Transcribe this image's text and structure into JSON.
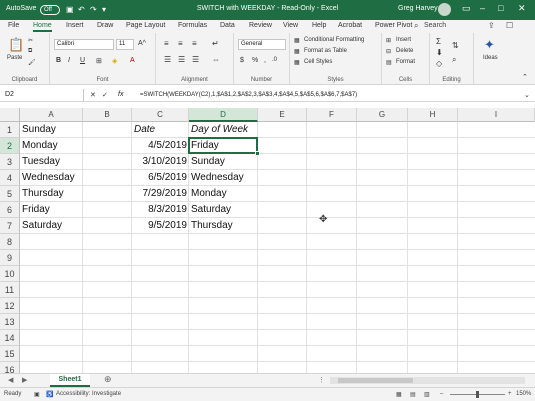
{
  "titlebar": {
    "autosave_label": "AutoSave",
    "autosave_state": "Off",
    "title": "SWITCH with WEEKDAY - Read-Only - Excel",
    "user": "Greg Harvey"
  },
  "tabs": [
    "File",
    "Home",
    "Insert",
    "Draw",
    "Page Layout",
    "Formulas",
    "Data",
    "Review",
    "View",
    "Help",
    "Acrobat",
    "Power Pivot"
  ],
  "active_tab": "Home",
  "search_label": "Search",
  "ribbon": {
    "clipboard": {
      "paste": "Paste",
      "label": "Clipboard"
    },
    "font": {
      "name": "Calibri",
      "size": "11",
      "label": "Font"
    },
    "alignment": {
      "label": "Alignment"
    },
    "number": {
      "format": "General",
      "label": "Number"
    },
    "styles": {
      "conditional": "Conditional Formatting",
      "table": "Format as Table",
      "cell": "Cell Styles",
      "label": "Styles"
    },
    "cells": {
      "insert": "Insert",
      "delete": "Delete",
      "format": "Format",
      "label": "Cells"
    },
    "editing": {
      "label": "Editing"
    },
    "ideas": {
      "label": "Ideas"
    }
  },
  "formula_bar": {
    "name_box": "D2",
    "fx": "fx",
    "formula": "=SWITCH(WEEKDAY(C2),1,$A$1,2,$A$2,3,$A$3,4,$A$4,5,$A$5,6,$A$6,7,$A$7)"
  },
  "columns": [
    "A",
    "B",
    "C",
    "D",
    "E",
    "F",
    "G",
    "H",
    "I"
  ],
  "selected_column": "D",
  "rows": [
    "1",
    "2",
    "3",
    "4",
    "5",
    "6",
    "7",
    "8",
    "9",
    "10",
    "11",
    "12",
    "13",
    "14",
    "15",
    "16"
  ],
  "selected_row": "2",
  "cells": {
    "A": [
      "Sunday",
      "Monday",
      "Tuesday",
      "Wednesday",
      "Thursday",
      "Friday",
      "Saturday"
    ],
    "C": [
      "Date",
      "4/5/2019",
      "3/10/2019",
      "6/5/2019",
      "7/29/2019",
      "8/3/2019",
      "9/5/2019"
    ],
    "D": [
      "Day of Week",
      "Friday",
      "Sunday",
      "Wednesday",
      "Monday",
      "Saturday",
      "Thursday"
    ]
  },
  "sheet_tabs": [
    "Sheet1"
  ],
  "status": {
    "ready": "Ready",
    "accessibility": "Accessibility: Investigate",
    "zoom": "150%"
  }
}
